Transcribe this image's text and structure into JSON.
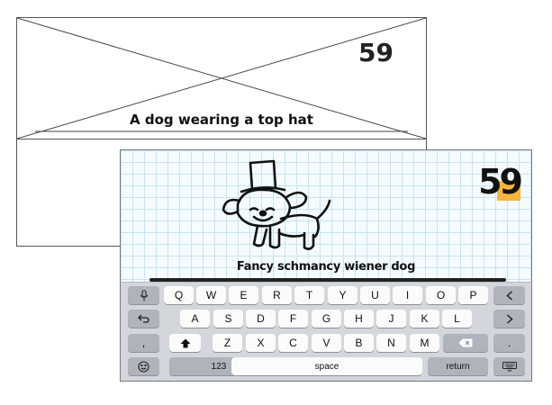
{
  "wireframe": {
    "score": "59",
    "caption": "A dog wearing a top hat"
  },
  "game": {
    "score": "59",
    "caption": "Fancy schmancy wiener dog"
  },
  "keyboard": {
    "row1": [
      "Q",
      "W",
      "E",
      "R",
      "T",
      "Y",
      "U",
      "I",
      "O",
      "P"
    ],
    "row2": [
      "A",
      "S",
      "D",
      "F",
      "G",
      "H",
      "J",
      "K",
      "L"
    ],
    "row3": [
      "Z",
      "X",
      "C",
      "V",
      "B",
      "N",
      "M"
    ],
    "comma": ",",
    "period": ".",
    "numbers_label": "123",
    "space_label": "space",
    "return_label": "return"
  },
  "colors": {
    "score_highlight": "#f6b63b",
    "grid_line": "#c7e4f1",
    "keyboard_bg": "#d3d6db"
  }
}
